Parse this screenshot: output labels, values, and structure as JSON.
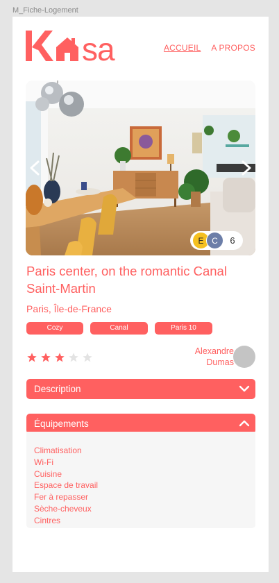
{
  "frame_label": "M_Fiche-Logement",
  "brand": {
    "name": "Kasa",
    "color": "#ff6060"
  },
  "nav": [
    {
      "label": "ACCUEIL",
      "active": true
    },
    {
      "label": "A PROPOS",
      "active": false
    }
  ],
  "gallery": {
    "prev_icon": "chevron-left-icon",
    "next_icon": "chevron-right-icon",
    "viewers": [
      "E",
      "C"
    ],
    "viewer_count": "6"
  },
  "listing": {
    "title": "Paris center, on the romantic Canal Saint-Martin",
    "location": "Paris, Île-de-France",
    "tags": [
      "Cozy",
      "Canal",
      "Paris 10"
    ],
    "rating": 3,
    "rating_max": 5,
    "host": {
      "first_name": "Alexandre",
      "last_name": "Dumas"
    }
  },
  "sections": {
    "description": {
      "label": "Description",
      "expanded": false
    },
    "equipments": {
      "label": "Équipements",
      "expanded": true,
      "items": [
        "Climatisation",
        "Wi-Fi",
        "Cuisine",
        "Espace de travail",
        "Fer à repasser",
        "Sèche-cheveux",
        "Cintres"
      ]
    }
  }
}
